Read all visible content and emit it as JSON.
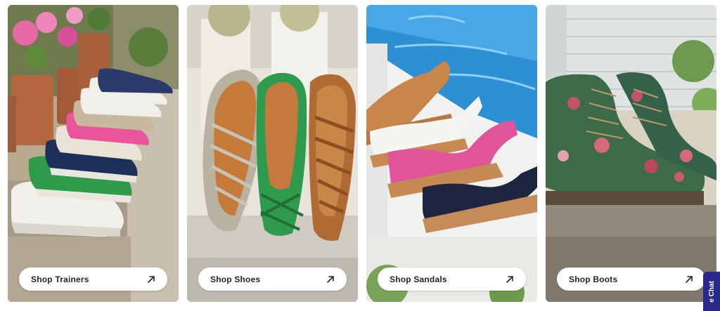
{
  "categories": [
    {
      "label": "Shop Trainers",
      "image_icon": "trainers-photo"
    },
    {
      "label": "Shop Shoes",
      "image_icon": "shoes-photo"
    },
    {
      "label": "Shop Sandals",
      "image_icon": "sandals-photo"
    },
    {
      "label": "Shop Boots",
      "image_icon": "boots-photo"
    }
  ],
  "chat": {
    "label": "Live Chat",
    "visible_fragment": "e Chat"
  },
  "colors": {
    "button_text": "#1f2230",
    "chat_tab": "#2a2a8a"
  }
}
